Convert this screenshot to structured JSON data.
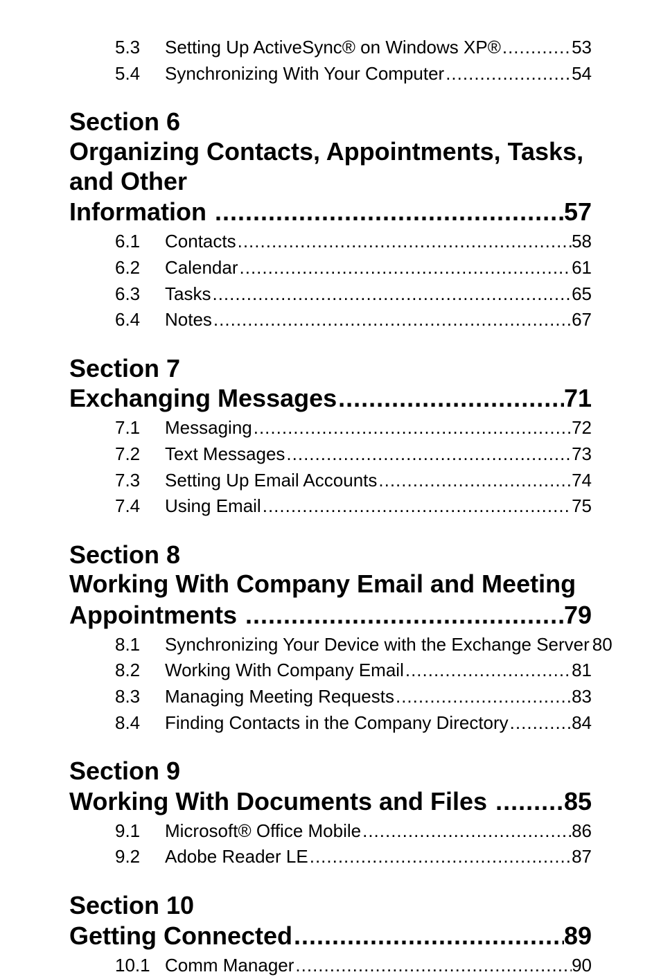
{
  "orphan_subs": [
    {
      "num": "5.3",
      "label": "Setting Up ActiveSync® on Windows XP®",
      "page": "53"
    },
    {
      "num": "5.4",
      "label": "Synchronizing With Your Computer",
      "page": "54"
    }
  ],
  "sections": [
    {
      "heading": "Section 6",
      "title_lines": [
        "Organizing Contacts, Appointments, Tasks, and Other"
      ],
      "title_tail": {
        "label": "Information ",
        "page": "57"
      },
      "subs": [
        {
          "num": "6.1",
          "label": "Contacts",
          "page": "58"
        },
        {
          "num": "6.2",
          "label": "Calendar",
          "page": "61"
        },
        {
          "num": "6.3",
          "label": "Tasks",
          "page": "65"
        },
        {
          "num": "6.4",
          "label": "Notes",
          "page": "67"
        }
      ]
    },
    {
      "heading": "Section 7",
      "title_lines": [],
      "title_tail": {
        "label": "Exchanging Messages",
        "page": "71"
      },
      "subs": [
        {
          "num": "7.1",
          "label": "Messaging",
          "page": "72"
        },
        {
          "num": "7.2",
          "label": "Text Messages",
          "page": "73"
        },
        {
          "num": "7.3",
          "label": "Setting Up Email Accounts",
          "page": "74"
        },
        {
          "num": "7.4",
          "label": "Using Email",
          "page": "75"
        }
      ]
    },
    {
      "heading": "Section 8",
      "title_lines": [
        "Working With Company Email and Meeting"
      ],
      "title_tail": {
        "label": "Appointments ",
        "page": "79"
      },
      "subs": [
        {
          "num": "8.1",
          "label": "Synchronizing Your Device with the Exchange Server",
          "page": "80"
        },
        {
          "num": "8.2",
          "label": "Working With Company Email",
          "page": "81"
        },
        {
          "num": "8.3",
          "label": "Managing Meeting Requests",
          "page": "83"
        },
        {
          "num": "8.4",
          "label": "Finding Contacts in the Company Directory",
          "page": "84"
        }
      ]
    },
    {
      "heading": "Section 9",
      "title_lines": [],
      "title_tail": {
        "label": "Working With Documents and Files ",
        "page": "85"
      },
      "subs": [
        {
          "num": "9.1",
          "label": "Microsoft® Office Mobile",
          "page": "86"
        },
        {
          "num": "9.2",
          "label": "Adobe Reader LE",
          "page": "87"
        }
      ]
    },
    {
      "heading": "Section 10",
      "title_lines": [],
      "title_tail": {
        "label": "Getting Connected",
        "page": "89"
      },
      "subs": [
        {
          "num": "10.1",
          "label": "Comm Manager",
          "page": "90"
        }
      ]
    }
  ],
  "dot_fill": "........................................................................................................................................................................"
}
